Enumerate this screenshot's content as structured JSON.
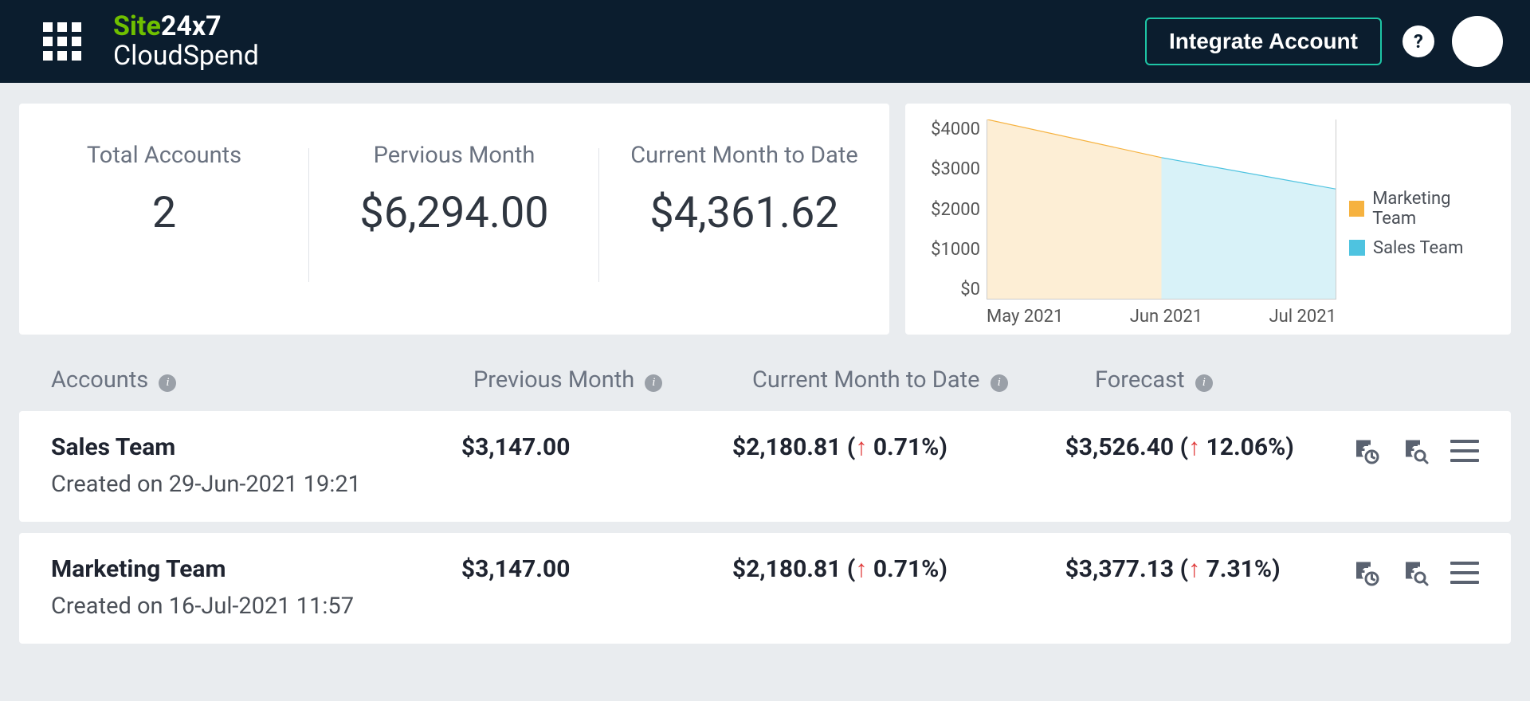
{
  "header": {
    "logo_site": "Site",
    "logo_24x7": "24x7",
    "logo_sub": "CloudSpend",
    "integrate": "Integrate Account",
    "help": "?"
  },
  "summary": {
    "m1_label": "Total Accounts",
    "m1_value": "2",
    "m2_label": "Pervious Month",
    "m2_value": "$6,294.00",
    "m3_label": "Current Month to Date",
    "m3_value": "$4,361.62"
  },
  "chart_data": {
    "type": "area",
    "y_ticks": [
      "$4000",
      "$3000",
      "$2000",
      "$1000",
      "$0"
    ],
    "x_categories": [
      "May 2021",
      "Jun 2021",
      "Jul 2021"
    ],
    "ylim": [
      0,
      4000
    ],
    "series": [
      {
        "name": "Marketing Team",
        "color": "#f6b23f",
        "values": [
          4300,
          3150,
          0
        ]
      },
      {
        "name": "Sales Team",
        "color": "#4ec3e0",
        "values": [
          0,
          3150,
          2450
        ]
      }
    ]
  },
  "table": {
    "h_accounts": "Accounts",
    "h_prev": "Previous Month",
    "h_curr": "Current Month to Date",
    "h_fore": "Forecast"
  },
  "rows": [
    {
      "name": "Sales Team",
      "created": "Created on 29-Jun-2021 19:21",
      "prev": "$3,147.00",
      "curr": "$2,180.81 (",
      "curr_delta": " 0.71%)",
      "fore": "$3,526.40 (",
      "fore_delta": " 12.06%)"
    },
    {
      "name": "Marketing Team",
      "created": "Created on 16-Jul-2021 11:57",
      "prev": "$3,147.00",
      "curr": "$2,180.81 (",
      "curr_delta": " 0.71%)",
      "fore": "$3,377.13 (",
      "fore_delta": " 7.31%)"
    }
  ]
}
